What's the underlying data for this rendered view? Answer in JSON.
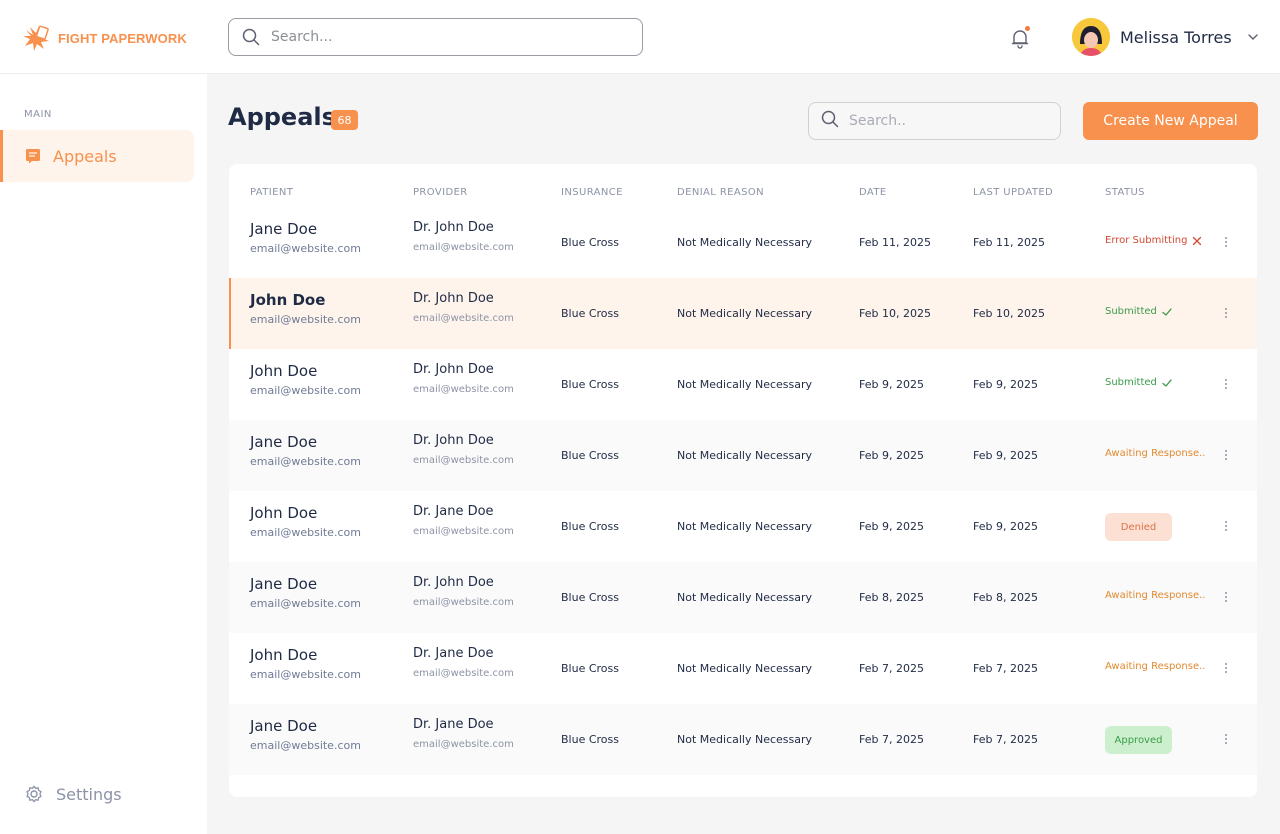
{
  "app": {
    "name": "FIGHT PAPERWORK"
  },
  "topbar": {
    "search_placeholder": "Search...",
    "user_name": "Melissa Torres",
    "notification_icon": "bell-icon"
  },
  "sidebar": {
    "section": "MAIN",
    "items": [
      {
        "label": "Appeals",
        "icon": "document-icon",
        "active": true
      }
    ],
    "settings_label": "Settings"
  },
  "page": {
    "title": "Appeals",
    "count": "68",
    "search_placeholder": "Search..",
    "create_label": "Create New Appeal"
  },
  "colors": {
    "accent": "#f7914d",
    "error": "#d24a33",
    "success": "#3b9b49",
    "warning": "#e08a2f"
  },
  "table": {
    "columns": [
      "PATIENT",
      "PROVIDER",
      "INSURANCE",
      "DENIAL REASON",
      "DATE",
      "LAST UPDATED",
      "STATUS"
    ],
    "rows": [
      {
        "patient": "Jane Doe",
        "patient_email": "email@website.com",
        "provider": "Dr. John Doe",
        "provider_email": "email@website.com",
        "insurance": "Blue Cross",
        "reason": "Not Medically Necessary",
        "date": "Feb 11, 2025",
        "updated": "Feb 11, 2025",
        "status": "Error Submitting",
        "status_type": "error"
      },
      {
        "patient": "John Doe",
        "patient_email": "email@website.com",
        "provider": "Dr. John Doe",
        "provider_email": "email@website.com",
        "insurance": "Blue Cross",
        "reason": "Not Medically Necessary",
        "date": "Feb 10, 2025",
        "updated": "Feb 10, 2025",
        "status": "Submitted",
        "status_type": "submitted",
        "selected": true
      },
      {
        "patient": "John Doe",
        "patient_email": "email@website.com",
        "provider": "Dr. John Doe",
        "provider_email": "email@website.com",
        "insurance": "Blue Cross",
        "reason": "Not Medically Necessary",
        "date": "Feb 9, 2025",
        "updated": "Feb 9, 2025",
        "status": "Submitted",
        "status_type": "submitted"
      },
      {
        "patient": "Jane Doe",
        "patient_email": "email@website.com",
        "provider": "Dr. John Doe",
        "provider_email": "email@website.com",
        "insurance": "Blue Cross",
        "reason": "Not Medically Necessary",
        "date": "Feb 9, 2025",
        "updated": "Feb 9, 2025",
        "status": "Awaiting Response...",
        "status_type": "awaiting"
      },
      {
        "patient": "John Doe",
        "patient_email": "email@website.com",
        "provider": "Dr. Jane Doe",
        "provider_email": "email@website.com",
        "insurance": "Blue Cross",
        "reason": "Not Medically Necessary",
        "date": "Feb 9, 2025",
        "updated": "Feb 9, 2025",
        "status": "Denied",
        "status_type": "denied"
      },
      {
        "patient": "Jane Doe",
        "patient_email": "email@website.com",
        "provider": "Dr. John Doe",
        "provider_email": "email@website.com",
        "insurance": "Blue Cross",
        "reason": "Not Medically Necessary",
        "date": "Feb 8, 2025",
        "updated": "Feb 8, 2025",
        "status": "Awaiting Response...",
        "status_type": "awaiting"
      },
      {
        "patient": "John Doe",
        "patient_email": "email@website.com",
        "provider": "Dr. Jane Doe",
        "provider_email": "email@website.com",
        "insurance": "Blue Cross",
        "reason": "Not Medically Necessary",
        "date": "Feb 7, 2025",
        "updated": "Feb 7, 2025",
        "status": "Awaiting Response...",
        "status_type": "awaiting"
      },
      {
        "patient": "Jane Doe",
        "patient_email": "email@website.com",
        "provider": "Dr. Jane Doe",
        "provider_email": "email@website.com",
        "insurance": "Blue Cross",
        "reason": "Not Medically Necessary",
        "date": "Feb 7, 2025",
        "updated": "Feb 7, 2025",
        "status": "Approved",
        "status_type": "approved"
      }
    ]
  }
}
